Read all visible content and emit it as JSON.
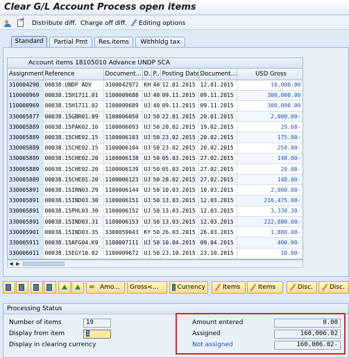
{
  "window": {
    "title": "Clear G/L Account Process open items"
  },
  "toolbar": {
    "items": [
      {
        "icon": "people-icon",
        "label": ""
      },
      {
        "icon": "edit-doc-icon",
        "label": ""
      },
      {
        "icon": "",
        "label": "Distribute diff."
      },
      {
        "icon": "",
        "label": "Charge off diff."
      },
      {
        "icon": "pencil-icon",
        "label": "Editing options"
      }
    ]
  },
  "tabs": [
    {
      "label": "Standard",
      "active": true
    },
    {
      "label": "Partial Pmt",
      "active": false
    },
    {
      "label": "Res.items",
      "active": false
    },
    {
      "label": "Withhldg tax",
      "active": false
    }
  ],
  "grid": {
    "title": "Account items 18105010 Advance UNDP SCA",
    "columns": [
      "Assignment",
      "Reference",
      "Document...",
      "D..",
      "P..",
      "Posting Date",
      "Document...",
      "USD Gross"
    ],
    "rows": [
      [
        "310004290",
        "00038.UNDP ADV",
        "3100042972",
        "KH",
        "40",
        "12.01.2015",
        "12.01.2015",
        "10,000.00"
      ],
      [
        "110000969",
        "00038.15H1711.01",
        "1100009688",
        "UJ",
        "40",
        "09.11.2015",
        "09.11.2015",
        "300,000.00"
      ],
      [
        "110000969",
        "00038.15H1711.02",
        "1100009689",
        "UJ",
        "40",
        "09.11.2015",
        "09.11.2015",
        "300,000.00"
      ],
      [
        "330005877",
        "00038.15GBR01.09",
        "1100006050",
        "UJ",
        "50",
        "22.01.2015",
        "20.01.2015",
        "2,000.00-"
      ],
      [
        "330005889",
        "00038.15PAK02.16",
        "1100006093",
        "UJ",
        "50",
        "20.02.2015",
        "19.02.2015",
        "29.68-"
      ],
      [
        "330005889",
        "00038.15CHE02.15",
        "1100006103",
        "UJ",
        "50",
        "23.02.2015",
        "20.02.2015",
        "175.00-"
      ],
      [
        "330005889",
        "00038.15CHE02.15",
        "1100006104",
        "UJ",
        "50",
        "23.02.2015",
        "20.02.2015",
        "250.00-"
      ],
      [
        "330005889",
        "00038.15CHE02.20",
        "1100006138",
        "UJ",
        "50",
        "05.03.2015",
        "27.02.2015",
        "148.00-"
      ],
      [
        "330005889",
        "00038.15CHE02.20",
        "1100006139",
        "UJ",
        "50",
        "05.03.2015",
        "27.02.2015",
        "20.00-"
      ],
      [
        "330005889",
        "00038.15CHE01.20",
        "1100006123",
        "UJ",
        "50",
        "28.02.2015",
        "27.02.2015",
        "148.00-"
      ],
      [
        "330005891",
        "00038.15IRN03.29",
        "1100006144",
        "UJ",
        "50",
        "10.03.2015",
        "10.03.2015",
        "2,000.00-"
      ],
      [
        "330005891",
        "00038.15IND03.30",
        "1100006151",
        "UJ",
        "50",
        "13.03.2015",
        "12.03.2015",
        "216,475.00-"
      ],
      [
        "330005891",
        "00038.15PHL03.30",
        "1100006152",
        "UJ",
        "50",
        "13.03.2015",
        "12.03.2015",
        "3,330.30-"
      ],
      [
        "330005891",
        "00038.15IND03.31",
        "1100006153",
        "UJ",
        "50",
        "13.03.2015",
        "12.03.2015",
        "222,880.00-"
      ],
      [
        "330005901",
        "00038.15IND03.35",
        "3300059043",
        "KY",
        "50",
        "26.03.2015",
        "26.03.2015",
        "1,880.00-"
      ],
      [
        "330005911",
        "00038.15AFG04.K9",
        "1100007111",
        "UJ",
        "50",
        "10.04.2015",
        "09.04.2015",
        "400.00-"
      ],
      [
        "330006011",
        "00038.15EGY10.02",
        "1100009672",
        "UJ",
        "50",
        "23.10.2015",
        "23.10.2015",
        "10.00-"
      ]
    ]
  },
  "grid_toolbar": {
    "buttons": [
      {
        "icon": "select-all-icon",
        "label": ""
      },
      {
        "icon": "deselect-all-icon",
        "label": ""
      },
      {
        "icon": "select-block-icon",
        "label": ""
      },
      {
        "icon": "deselect-block-icon",
        "label": ""
      },
      {
        "icon": "sort-ascending-icon",
        "label": ""
      },
      {
        "icon": "sort-descending-icon",
        "label": ""
      },
      {
        "icon": "binoculars-icon",
        "label": "Amo..."
      },
      {
        "icon": "",
        "label": "Gross<..."
      },
      {
        "icon": "currency-icon",
        "label": "Currency"
      },
      {
        "icon": "pencil-icon",
        "label": "Items"
      },
      {
        "icon": "pencil-icon",
        "label": "Items"
      },
      {
        "icon": "pencil-icon",
        "label": "Disc."
      },
      {
        "icon": "pencil-icon",
        "label": "Disc."
      }
    ]
  },
  "processing_status": {
    "title": "Processing Status",
    "number_of_items_label": "Number of items",
    "number_of_items_value": "19",
    "display_from_item_label": "Display from item",
    "display_from_item_value": "1",
    "display_clearing_currency_label": "Display in clearing currency",
    "amount_entered_label": "Amount entered",
    "amount_entered_value": "0.00",
    "assigned_label": "Assigned",
    "assigned_value": "160,006.02",
    "not_assigned_label": "Not assigned",
    "not_assigned_value": "160,006.02-"
  },
  "colors": {
    "highlight_border": "#e0201c",
    "link_blue": "#1f4fa8",
    "button_gold": "#f3dc8f"
  }
}
